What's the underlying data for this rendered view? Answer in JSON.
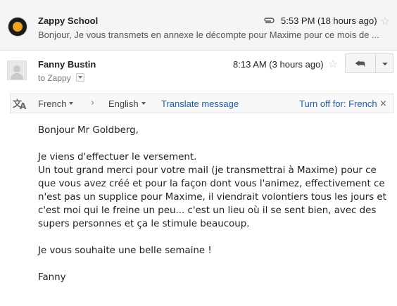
{
  "thread": {
    "collapsed_message": {
      "sender": "Zappy School",
      "time": "5:53 PM (18 hours ago)",
      "snippet": "Bonjour, Je vous transmets en annexe le décompte pour Maxime pour ce mois de ..."
    },
    "open_message": {
      "sender": "Fanny Bustin",
      "to": "to Zappy",
      "time": "8:13 AM (3 hours ago)"
    }
  },
  "translate_bar": {
    "source_lang": "French",
    "separator": "›",
    "target_lang": "English",
    "translate_label": "Translate message",
    "turn_off_label": "Turn off for: French",
    "close_glyph": "×"
  },
  "icons": {
    "star": "☆",
    "reply": "⮪",
    "translate_a1": "文",
    "translate_a2": "A"
  },
  "body": {
    "greeting": "Bonjour Mr Goldberg,",
    "lines": [
      "Je viens d'effectuer le versement.",
      "Un tout grand merci pour votre mail (je transmettrai à Maxime) pour ce",
      "que vous avez créé et pour la façon dont vous l'animez, effectivement ce",
      "n'est pas un supplice pour Maxime, il viendrait volontiers tous les jours et",
      "c'est moi qui le freine un peu... c'est un lieu où il se sent bien, avec des",
      "supers personnes et ça le stimule beaucoup."
    ],
    "closing": "Je vous souhaite une belle semaine !",
    "signature": "Fanny"
  },
  "colors": {
    "link": "#1a5db4",
    "logo_accent": "#f0a41c",
    "collapsed_bg": "#f5f5f5"
  }
}
